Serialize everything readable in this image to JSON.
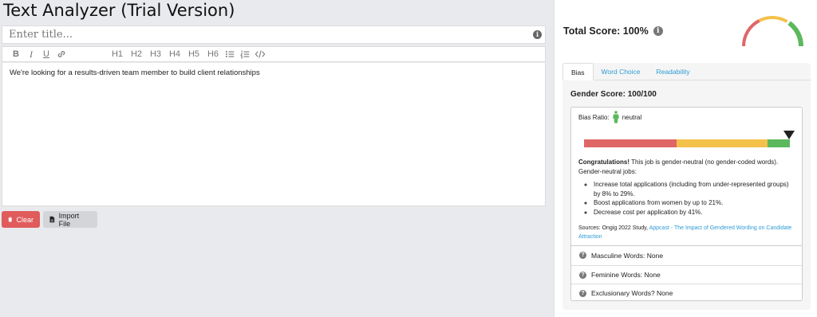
{
  "app": {
    "title": "Text Analyzer (Trial Version)"
  },
  "editor": {
    "title_placeholder": "Enter title...",
    "toolbar": {
      "bold": "B",
      "italic": "I",
      "underline": "U",
      "headings": [
        "H1",
        "H2",
        "H3",
        "H4",
        "H5",
        "H6"
      ]
    },
    "content": "We're looking for a results-driven team member to build client relationships"
  },
  "actions": {
    "clear_label": "Clear",
    "import_label": "Import File"
  },
  "score": {
    "label": "Total Score: 100%",
    "gauge_percent": 100,
    "colors": {
      "red": "#e06666",
      "yellow": "#f4c14a",
      "green": "#5cb85c"
    }
  },
  "tabs": [
    {
      "label": "Bias",
      "active": true
    },
    {
      "label": "Word Choice",
      "active": false
    },
    {
      "label": "Readability",
      "active": false
    }
  ],
  "bias": {
    "gender_score": "Gender Score: 100/100",
    "ratio_label": "Bias Ratio:",
    "ratio_value": "neutral",
    "bar_colors": {
      "masculine": "#e06666",
      "neutral": "#f4c14a",
      "feminine": "#5cb85c"
    },
    "marker_percent": 100,
    "congrats_bold": "Congratulations!",
    "congrats_text": " This job is gender-neutral (no gender-coded words). Gender-neutral jobs:",
    "benefits": [
      "Increase total applications (including from under-represented groups) by 8% to 29%.",
      "Boost applications from women by up to 21%.",
      "Decrease cost per application by 41%."
    ],
    "sources_prefix": "Sources: Ongig 2022 Study, ",
    "sources_link": "Appcast - The Impact of Gendered Wording on Candidate Attraction"
  },
  "word_lists": [
    {
      "label": "Masculine Words: None"
    },
    {
      "label": "Feminine Words: None"
    },
    {
      "label": "Exclusionary Words? None"
    }
  ]
}
